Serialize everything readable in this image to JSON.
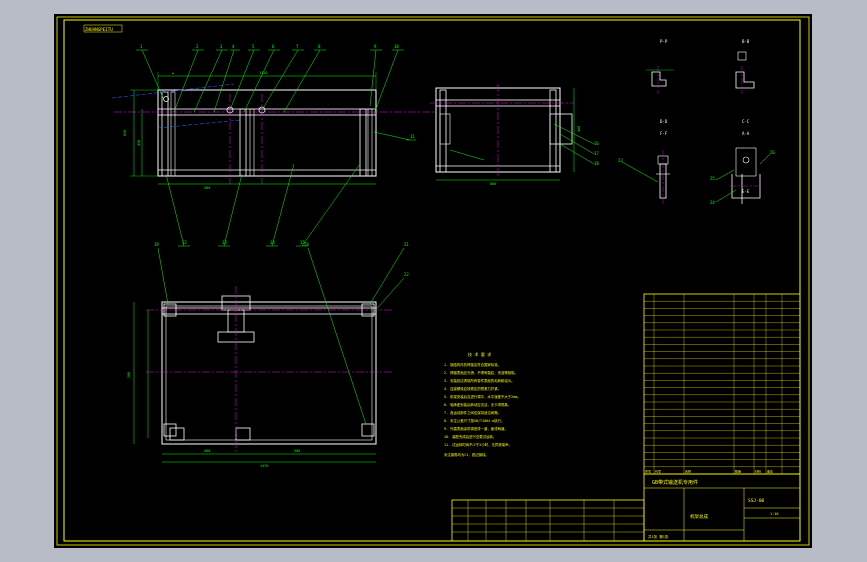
{
  "sheet": {
    "corner_tag": "ZHUANGPEITU",
    "colors": {
      "background": "#000000",
      "frame": "#ffff00",
      "part": "#ffffff",
      "dimension": "#00ff00",
      "centerline": "#ff00ff",
      "hidden": "#0000ff",
      "annotation": "#ff0000"
    }
  },
  "views": {
    "front": {
      "balloons": [
        "1",
        "2",
        "3",
        "4",
        "5",
        "6",
        "7",
        "8",
        "9",
        "10",
        "11"
      ],
      "bottom_balloons": [
        "12",
        "13",
        "14",
        "15"
      ],
      "dims": [
        "985",
        "1110",
        "620",
        "450"
      ]
    },
    "side": {
      "dims": [
        "800",
        "460"
      ],
      "balloons": [
        "16",
        "17",
        "18"
      ]
    },
    "plan": {
      "balloons": [
        "19",
        "20",
        "21",
        "22"
      ],
      "dims": [
        "460",
        "505",
        "1470",
        "280"
      ]
    },
    "details": {
      "labels": [
        "P-P",
        "B-B",
        "D-D",
        "C-C",
        "F-F",
        "A-A",
        "E-E"
      ],
      "balloons": [
        "23",
        "24",
        "25",
        "26"
      ]
    }
  },
  "notes": {
    "heading": "技 术 要 求",
    "items": [
      "1. 钢结构件的焊接应符合国家标准。",
      "2. 焊缝表面应光滑，不得有裂纹、夹渣等缺陷。",
      "3. 安装前应清除所有零件表面的毛刺和油污。",
      "4. 连接螺栓应按规定的预紧力拧紧。",
      "5. 机架安装后应进行调平，水平误差不大于2mm。",
      "6. 轴承座安装后转动应灵活，无卡滞现象。",
      "7. 各运动部件之间应保持适当间隙。",
      "8. 未注公差尺寸按GB/T1804-m执行。",
      "9. 外露表面涂防锈底漆一道，面漆两道。",
      "10. 装配完成后进行空载试运转。",
      "11. 试运转时间不少于2小时，无异常噪声。"
    ],
    "footer": "未注倒角均为C1，锐边倒钝。"
  },
  "bom": {
    "rows": 24,
    "header": [
      "序号",
      "代号",
      "名称",
      "数量",
      "材料",
      "备注"
    ]
  },
  "title_block": {
    "title": "GB带式输送机专用件",
    "drawing_no": "SSJ-00",
    "name": "机架总成",
    "scale": "1:10",
    "sheet_info": "共1张 第1张"
  }
}
